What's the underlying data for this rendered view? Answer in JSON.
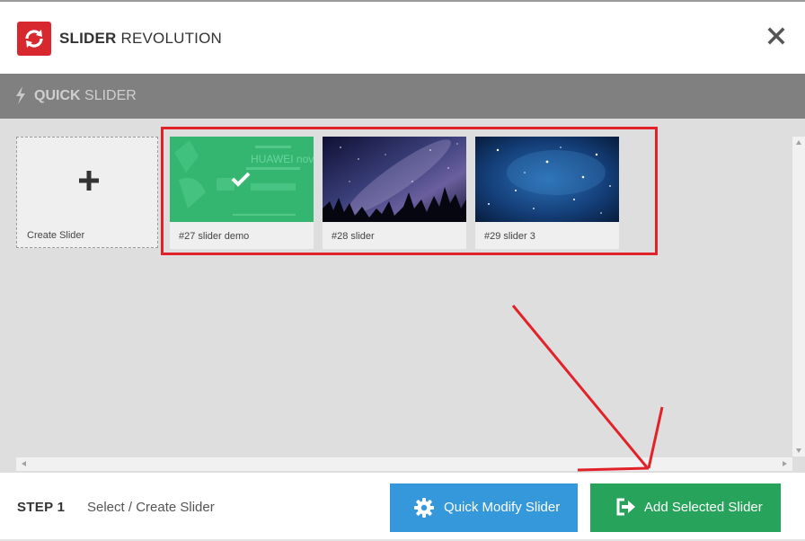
{
  "app": {
    "title_bold": "SLIDER",
    "title_rest": "REVOLUTION",
    "logo_icon": "refresh-icon",
    "accent_color": "#d7282f"
  },
  "quick_bar": {
    "title_bold": "QUICK",
    "title_rest": "SLIDER",
    "icon": "bolt-icon"
  },
  "create_tile": {
    "label": "Create Slider",
    "icon": "plus-icon"
  },
  "sliders": [
    {
      "label": "#27 slider demo",
      "selected": true,
      "thumb_overlay_text": "HUAWEI nova"
    },
    {
      "label": "#28 slider",
      "selected": false
    },
    {
      "label": "#29 slider 3",
      "selected": false
    }
  ],
  "footer": {
    "step_label": "STEP 1",
    "step_desc": "Select / Create Slider",
    "quick_modify_label": "Quick Modify Slider",
    "add_selected_label": "Add Selected Slider",
    "quick_modify_color": "#3498db",
    "add_selected_color": "#27a35b"
  },
  "annotation": {
    "highlight_color": "#e22229"
  }
}
